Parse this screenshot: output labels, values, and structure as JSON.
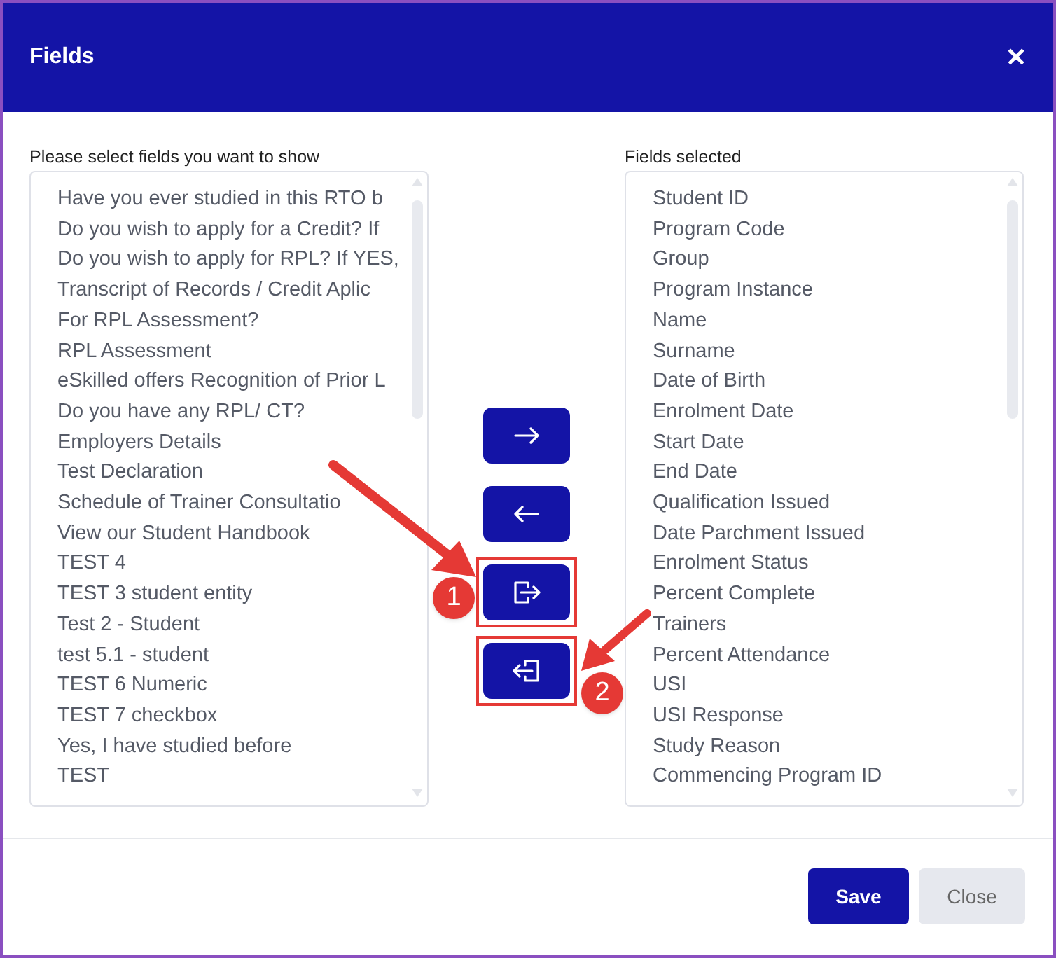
{
  "window": {
    "title": "Fields",
    "close": "✕"
  },
  "available": {
    "label": "Please select fields you want to show",
    "items": [
      "Have you ever studied in this RTO b",
      "Do you wish to apply for a Credit? If",
      "Do you wish to apply for RPL? If YES,",
      "Transcript of Records / Credit Aplic",
      "For RPL Assessment?",
      "RPL Assessment",
      "eSkilled offers Recognition of Prior L",
      "Do you have any RPL/ CT?",
      "Employers Details",
      "Test Declaration",
      "Schedule of Trainer Consultatio",
      "View our Student Handbook",
      "TEST 4",
      "TEST 3 student entity",
      "Test 2 - Student",
      "test 5.1 - student",
      "TEST 6 Numeric",
      "TEST 7 checkbox",
      "Yes, I have studied before",
      "TEST"
    ]
  },
  "transfer_buttons": [
    {
      "kind": "move-right",
      "highlighted": false
    },
    {
      "kind": "move-left",
      "highlighted": false
    },
    {
      "kind": "move-all-right",
      "highlighted": true
    },
    {
      "kind": "move-all-left",
      "highlighted": true
    }
  ],
  "annotations": [
    "1",
    "2"
  ],
  "selected": {
    "label": "Fields selected",
    "items": [
      "Student ID",
      "Program Code",
      "Group",
      "Program Instance",
      "Name",
      "Surname",
      "Date of Birth",
      "Enrolment Date",
      "Start Date",
      "End Date",
      "Qualification Issued",
      "Date Parchment Issued",
      "Enrolment Status",
      "Percent Complete",
      "Trainers",
      "Percent Attendance",
      "USI",
      "USI Response",
      "Study Reason",
      "Commencing Program ID"
    ]
  },
  "footer": {
    "buttons": [
      {
        "label": "Save",
        "kind": "primary"
      },
      {
        "label": "Close",
        "kind": "secondary"
      }
    ]
  }
}
